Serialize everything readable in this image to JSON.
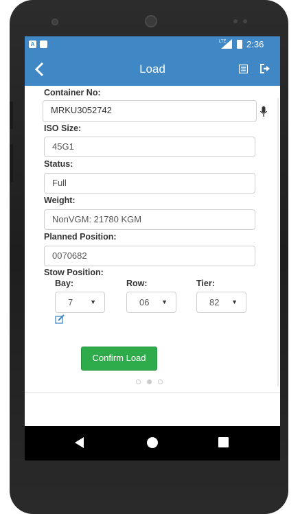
{
  "status_bar": {
    "network": "LTE",
    "time": "2:36"
  },
  "app_bar": {
    "title": "Load"
  },
  "form": {
    "container_no": {
      "label": "Container No:",
      "value": "MRKU3052742"
    },
    "iso_size": {
      "label": "ISO Size:",
      "value": "45G1"
    },
    "status": {
      "label": "Status:",
      "value": "Full"
    },
    "weight": {
      "label": "Weight:",
      "value": "NonVGM: 21780 KGM"
    },
    "planned_position": {
      "label": "Planned Position:",
      "value": "0070682"
    },
    "stow_position": {
      "label": "Stow Position:",
      "bay": {
        "label": "Bay:",
        "value": "7"
      },
      "row": {
        "label": "Row:",
        "value": "06"
      },
      "tier": {
        "label": "Tier:",
        "value": "82"
      }
    }
  },
  "confirm_button": {
    "label": "Confirm Load",
    "color": "#2eab4a"
  },
  "pager": {
    "pages": 3,
    "active_page": 2
  },
  "colors": {
    "app_bar": "#3f88c5"
  },
  "icons": {
    "back": "chevron-left-icon",
    "list": "list-icon",
    "logout": "logout-icon",
    "mic": "microphone-icon",
    "edit": "edit-icon"
  }
}
